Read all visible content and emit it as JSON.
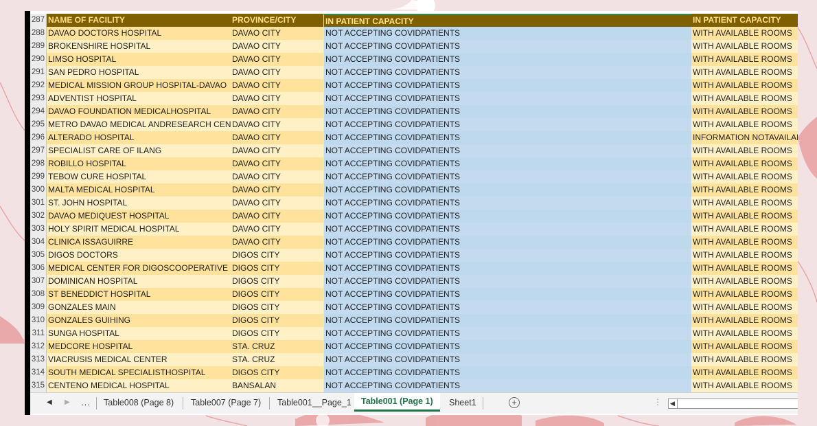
{
  "columns": {
    "name": "NAME OF FACILITY",
    "province": "PROVINCE/CITY",
    "capacity": "IN PATIENT CAPACITY",
    "availability": "IN PATIENT CAPACITY"
  },
  "header_row_num": "287",
  "rows": [
    {
      "n": "288",
      "name": "DAVAO DOCTORS HOSPITAL",
      "province": "DAVAO CITY",
      "capacity": "NOT ACCEPTING COVIDPATIENTS",
      "avail": "WITH AVAILABLE ROOMS"
    },
    {
      "n": "289",
      "name": "BROKENSHIRE HOSPITAL",
      "province": "DAVAO CITY",
      "capacity": "NOT ACCEPTING COVIDPATIENTS",
      "avail": "WITH AVAILABLE ROOMS"
    },
    {
      "n": "290",
      "name": "LIMSO HOSPITAL",
      "province": "DAVAO CITY",
      "capacity": "NOT ACCEPTING COVIDPATIENTS",
      "avail": "WITH AVAILABLE ROOMS"
    },
    {
      "n": "291",
      "name": "SAN PEDRO HOSPITAL",
      "province": "DAVAO CITY",
      "capacity": "NOT ACCEPTING COVIDPATIENTS",
      "avail": "WITH AVAILABLE ROOMS"
    },
    {
      "n": "292",
      "name": "MEDICAL MISSION GROUP HOSPITAL-DAVAO",
      "province": "DAVAO CITY",
      "capacity": "NOT ACCEPTING COVIDPATIENTS",
      "avail": "WITH AVAILABLE ROOMS"
    },
    {
      "n": "293",
      "name": "ADVENTIST HOSPITAL",
      "province": "DAVAO CITY",
      "capacity": "NOT ACCEPTING COVIDPATIENTS",
      "avail": "WITH AVAILABLE ROOMS"
    },
    {
      "n": "294",
      "name": "DAVAO FOUNDATION MEDICALHOSPITAL",
      "province": "DAVAO CITY",
      "capacity": "NOT ACCEPTING COVIDPATIENTS",
      "avail": "WITH AVAILABLE ROOMS"
    },
    {
      "n": "295",
      "name": "METRO DAVAO MEDICAL ANDRESEARCH CENTER",
      "province": "DAVAO CITY",
      "capacity": "NOT ACCEPTING COVIDPATIENTS",
      "avail": "WITH AVAILABLE ROOMS"
    },
    {
      "n": "296",
      "name": "ALTERADO HOSPITAL",
      "province": "DAVAO CITY",
      "capacity": "NOT ACCEPTING COVIDPATIENTS",
      "avail": "INFORMATION NOTAVAILABLE"
    },
    {
      "n": "297",
      "name": "SPECIALIST CARE OF ILANG",
      "province": "DAVAO CITY",
      "capacity": "NOT ACCEPTING COVIDPATIENTS",
      "avail": "WITH AVAILABLE ROOMS"
    },
    {
      "n": "298",
      "name": "ROBILLO HOSPITAL",
      "province": "DAVAO CITY",
      "capacity": "NOT ACCEPTING COVIDPATIENTS",
      "avail": "WITH AVAILABLE ROOMS"
    },
    {
      "n": "299",
      "name": "TEBOW CURE HOSPITAL",
      "province": "DAVAO CITY",
      "capacity": "NOT ACCEPTING COVIDPATIENTS",
      "avail": "WITH AVAILABLE ROOMS"
    },
    {
      "n": "300",
      "name": "MALTA MEDICAL HOSPITAL",
      "province": "DAVAO CITY",
      "capacity": "NOT ACCEPTING COVIDPATIENTS",
      "avail": "WITH AVAILABLE ROOMS"
    },
    {
      "n": "301",
      "name": "ST. JOHN HOSPITAL",
      "province": "DAVAO CITY",
      "capacity": "NOT ACCEPTING COVIDPATIENTS",
      "avail": "WITH AVAILABLE ROOMS"
    },
    {
      "n": "302",
      "name": "DAVAO MEDIQUEST HOSPITAL",
      "province": "DAVAO CITY",
      "capacity": "NOT ACCEPTING COVIDPATIENTS",
      "avail": "WITH AVAILABLE ROOMS"
    },
    {
      "n": "303",
      "name": "HOLY SPIRIT MEDICAL HOSPITAL",
      "province": "DAVAO CITY",
      "capacity": "NOT ACCEPTING COVIDPATIENTS",
      "avail": "WITH AVAILABLE ROOMS"
    },
    {
      "n": "304",
      "name": "CLINICA ISSAGUIRRE",
      "province": "DAVAO CITY",
      "capacity": "NOT ACCEPTING COVIDPATIENTS",
      "avail": "WITH AVAILABLE ROOMS"
    },
    {
      "n": "305",
      "name": "DIGOS DOCTORS",
      "province": "DIGOS CITY",
      "capacity": "NOT ACCEPTING COVIDPATIENTS",
      "avail": "WITH AVAILABLE ROOMS"
    },
    {
      "n": "306",
      "name": "MEDICAL CENTER FOR DIGOSCOOPERATIVE",
      "province": "DIGOS CITY",
      "capacity": "NOT ACCEPTING COVIDPATIENTS",
      "avail": "WITH AVAILABLE ROOMS"
    },
    {
      "n": "307",
      "name": "DOMINICAN HOSPITAL",
      "province": "DIGOS CITY",
      "capacity": "NOT ACCEPTING COVIDPATIENTS",
      "avail": "WITH AVAILABLE ROOMS"
    },
    {
      "n": "308",
      "name": "ST BENEDDICT HOSPITAL",
      "province": "DIGOS CITY",
      "capacity": "NOT ACCEPTING COVIDPATIENTS",
      "avail": "WITH AVAILABLE ROOMS"
    },
    {
      "n": "309",
      "name": "GONZALES MAIN",
      "province": "DIGOS CITY",
      "capacity": "NOT ACCEPTING COVIDPATIENTS",
      "avail": "WITH AVAILABLE ROOMS"
    },
    {
      "n": "310",
      "name": "GONZALES GUIHING",
      "province": "DIGOS CITY",
      "capacity": "NOT ACCEPTING COVIDPATIENTS",
      "avail": "WITH AVAILABLE ROOMS"
    },
    {
      "n": "311",
      "name": "SUNGA HOSPITAL",
      "province": "DIGOS CITY",
      "capacity": "NOT ACCEPTING COVIDPATIENTS",
      "avail": "WITH AVAILABLE ROOMS"
    },
    {
      "n": "312",
      "name": "MEDCORE HOSPITAL",
      "province": "STA. CRUZ",
      "capacity": "NOT ACCEPTING COVIDPATIENTS",
      "avail": "WITH AVAILABLE ROOMS"
    },
    {
      "n": "313",
      "name": "VIACRUSIS MEDICAL CENTER",
      "province": "STA. CRUZ",
      "capacity": "NOT ACCEPTING COVIDPATIENTS",
      "avail": "WITH AVAILABLE ROOMS"
    },
    {
      "n": "314",
      "name": "SOUTH MEDICAL SPECIALISTHOSPITAL",
      "province": "DIGOS CITY",
      "capacity": "NOT ACCEPTING COVIDPATIENTS",
      "avail": "WITH AVAILABLE ROOMS"
    },
    {
      "n": "315",
      "name": "CENTENO MEDICAL HOSPITAL",
      "province": "BANSALAN",
      "capacity": "NOT ACCEPTING COVIDPATIENTS",
      "avail": "WITH AVAILABLE ROOMS"
    }
  ],
  "tabs": {
    "ellipsis": "...",
    "items": [
      "Table008 (Page 8)",
      "Table007 (Page 7)",
      "Table001__Page_1",
      "Table001 (Page 1)",
      "Sheet1"
    ],
    "active": "Table001 (Page 1)",
    "add": "+"
  },
  "colors": {
    "header_bg": "#7f6000",
    "header_text": "#ffe08a",
    "row_yellow": "#ffe39c",
    "row_cream": "#fff0c6",
    "capacity_blue": "#bed8ee",
    "active_tab": "#1e7145",
    "background": "#f3e2e3",
    "flower": "#e8a0a2"
  }
}
